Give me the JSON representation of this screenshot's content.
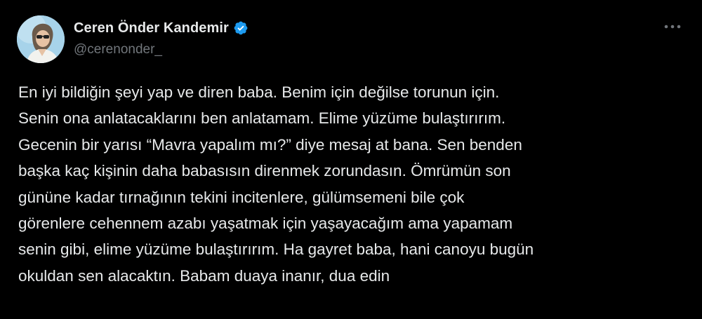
{
  "tweet": {
    "author": {
      "display_name": "Ceren Önder Kandemir",
      "handle": "@cerenonder_",
      "verified_icon": "verified-badge-icon",
      "avatar_icon": "profile-avatar"
    },
    "more_icon": "more-options-icon",
    "text": "En iyi bildiğin şeyi yap ve diren baba. Benim için değilse torunun için.\nSenin ona anlatacaklarını ben anlatamam. Elime yüzüme bulaştırırım.\nGecenin bir yarısı “Mavra yapalım mı?” diye mesaj at bana. Sen benden\nbaşka kaç kişinin daha babasısın direnmek zorundasın. Ömrümün son\ngününe kadar tırnağının tekini incitenlere, gülümsemeni bile çok\ngörenlere cehennem azabı yaşatmak için yaşayacağım ama yapamam\nsenin gibi, elime yüzüme bulaştırırım. Ha gayret baba, hani canoyu bugün\nokuldan sen alacaktın. Babam duaya inanır, dua edin"
  },
  "colors": {
    "background": "#000000",
    "text_primary": "#e7e9ea",
    "text_secondary": "#71767b",
    "verified_blue": "#1d9bf0"
  }
}
